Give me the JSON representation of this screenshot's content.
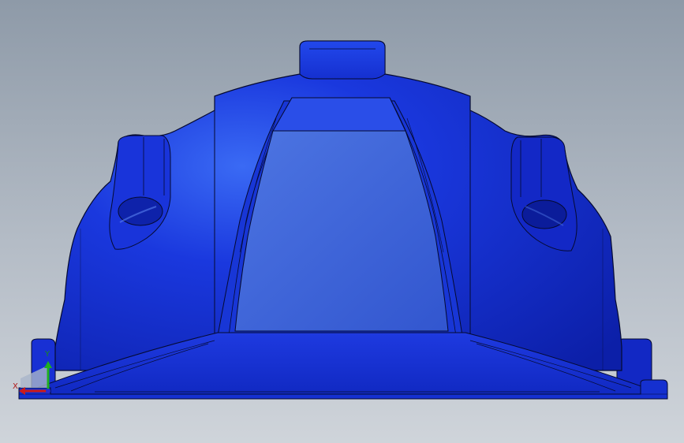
{
  "scene": {
    "background_top": "#8e9aa8",
    "background_bottom": "#cfd4da",
    "part_color": "#1a2fd8",
    "part_highlight": "#3360f0",
    "part_shadow": "#0b1a9a",
    "edge_color": "#050a30",
    "window_face": "#3a63d8",
    "window_face_highlight": "#5a80e6"
  },
  "triad": {
    "x_label": "X",
    "y_label": "Y",
    "x_color": "#cc1a1a",
    "y_color": "#1fb01f",
    "z_color": "#2a2ad0",
    "plane_color": "#a9b5c9"
  }
}
